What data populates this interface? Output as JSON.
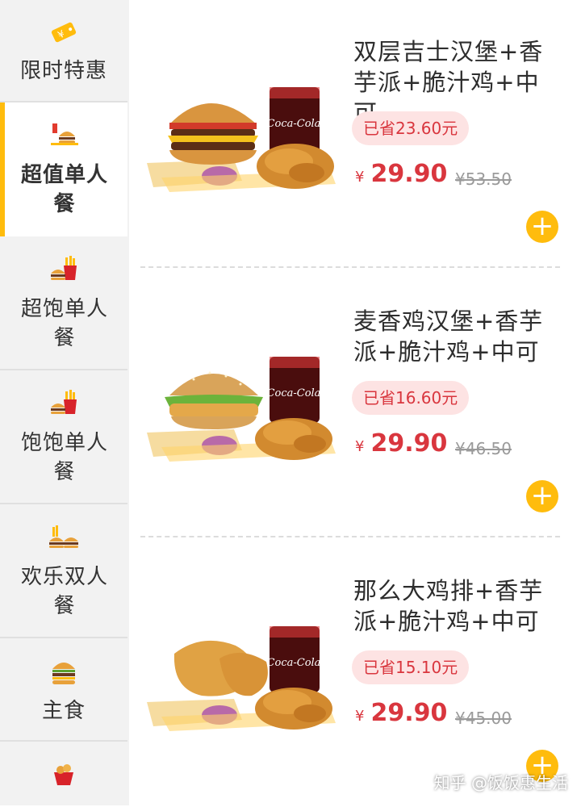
{
  "colors": {
    "accent": "#ffbc0d",
    "price": "#d9363e",
    "saved_bg": "#fde3e3",
    "sidebar_bg": "#f2f2f2"
  },
  "sidebar": {
    "items": [
      {
        "label": "限时特惠",
        "icon": "price-tag-icon",
        "active": false
      },
      {
        "label": "超值单人餐",
        "icon": "burger-meal-icon",
        "active": true
      },
      {
        "label": "超饱单人餐",
        "icon": "fries-burger-icon",
        "active": false
      },
      {
        "label": "饱饱单人餐",
        "icon": "fries-burger-icon",
        "active": false
      },
      {
        "label": "欢乐双人餐",
        "icon": "double-burger-icon",
        "active": false
      },
      {
        "label": "主食",
        "icon": "burger-icon",
        "active": false
      },
      {
        "label": "",
        "icon": "snack-icon",
        "active": false
      }
    ]
  },
  "products": [
    {
      "name": "双层吉士汉堡+香芋派+脆汁鸡+中可",
      "saved": "已省23.60元",
      "currency": "¥",
      "price": "29.90",
      "original_price": "¥53.50",
      "image": "double-cheeseburger-meal-image",
      "add_icon": "+"
    },
    {
      "name": "麦香鸡汉堡+香芋派+脆汁鸡+中可",
      "saved": "已省16.60元",
      "currency": "¥",
      "price": "29.90",
      "original_price": "¥46.50",
      "image": "mcchicken-meal-image",
      "add_icon": "+"
    },
    {
      "name": "那么大鸡排+香芋派+脆汁鸡+中可",
      "saved": "已省15.10元",
      "currency": "¥",
      "price": "29.90",
      "original_price": "¥45.00",
      "image": "chicken-cutlet-meal-image",
      "add_icon": "+"
    }
  ],
  "watermark": "知乎 @饭饭惠生活"
}
